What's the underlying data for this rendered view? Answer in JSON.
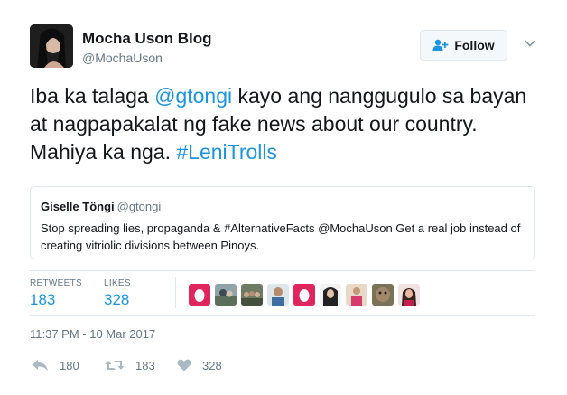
{
  "author": {
    "display_name": "Mocha Uson Blog",
    "handle": "@MochaUson"
  },
  "follow_button": {
    "label": "Follow",
    "icon": "person-add-icon"
  },
  "tweet": {
    "parts": [
      {
        "text": "Iba ka talaga ",
        "type": "text"
      },
      {
        "text": "@gtongi",
        "type": "mention"
      },
      {
        "text": " kayo ang nanggugulo sa bayan at nagpapakalat ng fake news about our country. Mahiya ka nga. ",
        "type": "text"
      },
      {
        "text": "#LeniTrolls",
        "type": "hashtag"
      }
    ]
  },
  "quote": {
    "name": "Giselle Töngi",
    "handle": "@gtongi",
    "text": "Stop spreading lies, propaganda & #AlternativeFacts @MochaUson Get a real job instead of creating vitriolic divisions between Pinoys."
  },
  "stats": {
    "retweets_label": "RETWEETS",
    "retweets_value": "183",
    "likes_label": "LIKES",
    "likes_value": "328"
  },
  "likers": [
    "egg-avatar",
    "photo-avatar",
    "photo-avatar",
    "photo-avatar",
    "egg-avatar",
    "photo-avatar",
    "photo-avatar",
    "photo-avatar",
    "photo-avatar"
  ],
  "timestamp": "11:37 PM - 10 Mar 2017",
  "actions": {
    "reply_count": "180",
    "retweet_count": "183",
    "like_count": "328"
  },
  "colors": {
    "link": "#1b95e0",
    "muted": "#657786",
    "border": "#e1e8ed",
    "egg": "#e0245e"
  }
}
